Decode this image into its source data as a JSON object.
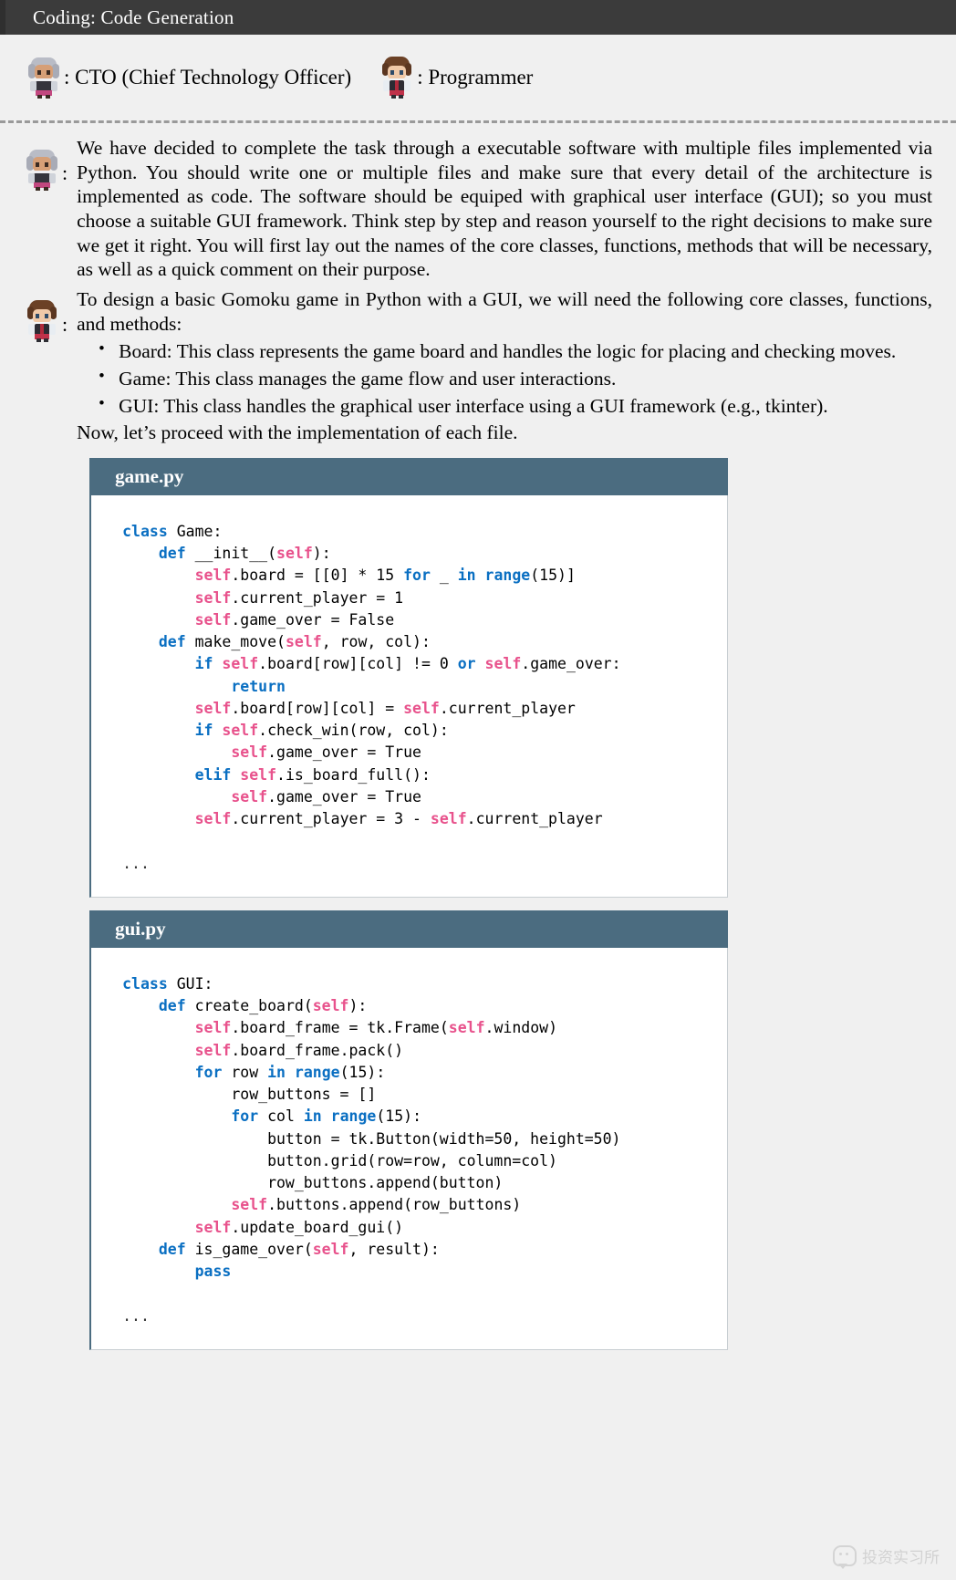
{
  "window": {
    "title": "Coding: Code Generation"
  },
  "legend": {
    "entries": [
      {
        "icon": "cto-avatar-icon",
        "label": ": CTO (Chief Technology Officer)"
      },
      {
        "icon": "programmer-avatar-icon",
        "label": ": Programmer"
      }
    ]
  },
  "conversation": [
    {
      "speaker": "cto",
      "colon": ":",
      "paragraphs": [
        "We have decided to complete the task through a executable software with multiple files implemented via Python. You should write one or multiple files and make sure that every detail of the architecture is implemented as code. The software should be equiped with graphical user interface (GUI); so you must choose a suitable GUI framework. Think step by step and reason yourself to the right decisions to make sure we get it right. You will first lay out the names of the core classes, functions, methods that will be necessary, as well as a quick comment on their purpose."
      ]
    },
    {
      "speaker": "programmer",
      "colon": ":",
      "intro": "To design a basic Gomoku game in Python with a GUI, we will need the following core classes, functions, and methods:",
      "bullets": [
        "Board: This class represents the game board and handles the logic for placing and checking moves.",
        "Game: This class manages the game flow and user interactions.",
        "GUI: This class handles the graphical user interface using a GUI framework (e.g., tkinter)."
      ],
      "outro": "Now, let’s proceed with the implementation of each file."
    }
  ],
  "code_blocks": [
    {
      "filename": "game.py",
      "lines": [
        [
          {
            "t": "class ",
            "c": "kw"
          },
          {
            "t": "Game:",
            "c": ""
          }
        ],
        [
          {
            "t": "    def ",
            "c": "kw"
          },
          {
            "t": "__init__(",
            "c": ""
          },
          {
            "t": "self",
            "c": "slf"
          },
          {
            "t": "):",
            "c": ""
          }
        ],
        [
          {
            "t": "        ",
            "c": ""
          },
          {
            "t": "self",
            "c": "slf"
          },
          {
            "t": ".board = [[0] * 15 ",
            "c": ""
          },
          {
            "t": "for",
            "c": "kw"
          },
          {
            "t": " _ ",
            "c": ""
          },
          {
            "t": "in ",
            "c": "kw"
          },
          {
            "t": "range",
            "c": "kw"
          },
          {
            "t": "(15)]",
            "c": ""
          }
        ],
        [
          {
            "t": "        ",
            "c": ""
          },
          {
            "t": "self",
            "c": "slf"
          },
          {
            "t": ".current_player = 1",
            "c": ""
          }
        ],
        [
          {
            "t": "        ",
            "c": ""
          },
          {
            "t": "self",
            "c": "slf"
          },
          {
            "t": ".game_over = False",
            "c": ""
          }
        ],
        [
          {
            "t": "    def ",
            "c": "kw"
          },
          {
            "t": "make_move(",
            "c": ""
          },
          {
            "t": "self",
            "c": "slf"
          },
          {
            "t": ", row, col):",
            "c": ""
          }
        ],
        [
          {
            "t": "        ",
            "c": ""
          },
          {
            "t": "if ",
            "c": "kw"
          },
          {
            "t": "self",
            "c": "slf"
          },
          {
            "t": ".board[row][col] != 0 ",
            "c": ""
          },
          {
            "t": "or ",
            "c": "kw"
          },
          {
            "t": "self",
            "c": "slf"
          },
          {
            "t": ".game_over:",
            "c": ""
          }
        ],
        [
          {
            "t": "            ",
            "c": ""
          },
          {
            "t": "return",
            "c": "kw"
          }
        ],
        [
          {
            "t": "        ",
            "c": ""
          },
          {
            "t": "self",
            "c": "slf"
          },
          {
            "t": ".board[row][col] = ",
            "c": ""
          },
          {
            "t": "self",
            "c": "slf"
          },
          {
            "t": ".current_player",
            "c": ""
          }
        ],
        [
          {
            "t": "        ",
            "c": ""
          },
          {
            "t": "if ",
            "c": "kw"
          },
          {
            "t": "self",
            "c": "slf"
          },
          {
            "t": ".check_win(row, col):",
            "c": ""
          }
        ],
        [
          {
            "t": "            ",
            "c": ""
          },
          {
            "t": "self",
            "c": "slf"
          },
          {
            "t": ".game_over = True",
            "c": ""
          }
        ],
        [
          {
            "t": "        ",
            "c": ""
          },
          {
            "t": "elif ",
            "c": "kw"
          },
          {
            "t": "self",
            "c": "slf"
          },
          {
            "t": ".is_board_full():",
            "c": ""
          }
        ],
        [
          {
            "t": "            ",
            "c": ""
          },
          {
            "t": "self",
            "c": "slf"
          },
          {
            "t": ".game_over = True",
            "c": ""
          }
        ],
        [
          {
            "t": "        ",
            "c": ""
          },
          {
            "t": "self",
            "c": "slf"
          },
          {
            "t": ".current_player = 3 - ",
            "c": ""
          },
          {
            "t": "self",
            "c": "slf"
          },
          {
            "t": ".current_player",
            "c": ""
          }
        ],
        [
          {
            "t": "",
            "c": ""
          }
        ],
        [
          {
            "t": "...",
            "c": "dots"
          }
        ]
      ]
    },
    {
      "filename": "gui.py",
      "lines": [
        [
          {
            "t": "class ",
            "c": "kw"
          },
          {
            "t": "GUI:",
            "c": ""
          }
        ],
        [
          {
            "t": "    def ",
            "c": "kw"
          },
          {
            "t": "create_board(",
            "c": ""
          },
          {
            "t": "self",
            "c": "slf"
          },
          {
            "t": "):",
            "c": ""
          }
        ],
        [
          {
            "t": "        ",
            "c": ""
          },
          {
            "t": "self",
            "c": "slf"
          },
          {
            "t": ".board_frame = tk.Frame(",
            "c": ""
          },
          {
            "t": "self",
            "c": "slf"
          },
          {
            "t": ".window)",
            "c": ""
          }
        ],
        [
          {
            "t": "        ",
            "c": ""
          },
          {
            "t": "self",
            "c": "slf"
          },
          {
            "t": ".board_frame.pack()",
            "c": ""
          }
        ],
        [
          {
            "t": "        ",
            "c": ""
          },
          {
            "t": "for ",
            "c": "kw"
          },
          {
            "t": "row ",
            "c": ""
          },
          {
            "t": "in ",
            "c": "kw"
          },
          {
            "t": "range",
            "c": "kw"
          },
          {
            "t": "(15):",
            "c": ""
          }
        ],
        [
          {
            "t": "            row_buttons = []",
            "c": ""
          }
        ],
        [
          {
            "t": "            ",
            "c": ""
          },
          {
            "t": "for ",
            "c": "kw"
          },
          {
            "t": "col ",
            "c": ""
          },
          {
            "t": "in ",
            "c": "kw"
          },
          {
            "t": "range",
            "c": "kw"
          },
          {
            "t": "(15):",
            "c": ""
          }
        ],
        [
          {
            "t": "                button = tk.Button(width=50, height=50)",
            "c": ""
          }
        ],
        [
          {
            "t": "                button.grid(row=row, column=col)",
            "c": ""
          }
        ],
        [
          {
            "t": "                row_buttons.append(button)",
            "c": ""
          }
        ],
        [
          {
            "t": "            ",
            "c": ""
          },
          {
            "t": "self",
            "c": "slf"
          },
          {
            "t": ".buttons.append(row_buttons)",
            "c": ""
          }
        ],
        [
          {
            "t": "        ",
            "c": ""
          },
          {
            "t": "self",
            "c": "slf"
          },
          {
            "t": ".update_board_gui()",
            "c": ""
          }
        ],
        [
          {
            "t": "    def ",
            "c": "kw"
          },
          {
            "t": "is_game_over(",
            "c": ""
          },
          {
            "t": "self",
            "c": "slf"
          },
          {
            "t": ", result):",
            "c": ""
          }
        ],
        [
          {
            "t": "        ",
            "c": ""
          },
          {
            "t": "pass",
            "c": "kw"
          }
        ],
        [
          {
            "t": "",
            "c": ""
          }
        ],
        [
          {
            "t": "...",
            "c": "dots"
          }
        ]
      ]
    }
  ],
  "watermark": {
    "icon": "wechat-icon",
    "text": "投资实习所"
  },
  "colors": {
    "titlebar_bg": "#3b3b3b",
    "page_bg": "#f0f0f0",
    "code_header_bg": "#4b6c80",
    "keyword": "#0a6fc2",
    "self_token": "#e8528c"
  }
}
